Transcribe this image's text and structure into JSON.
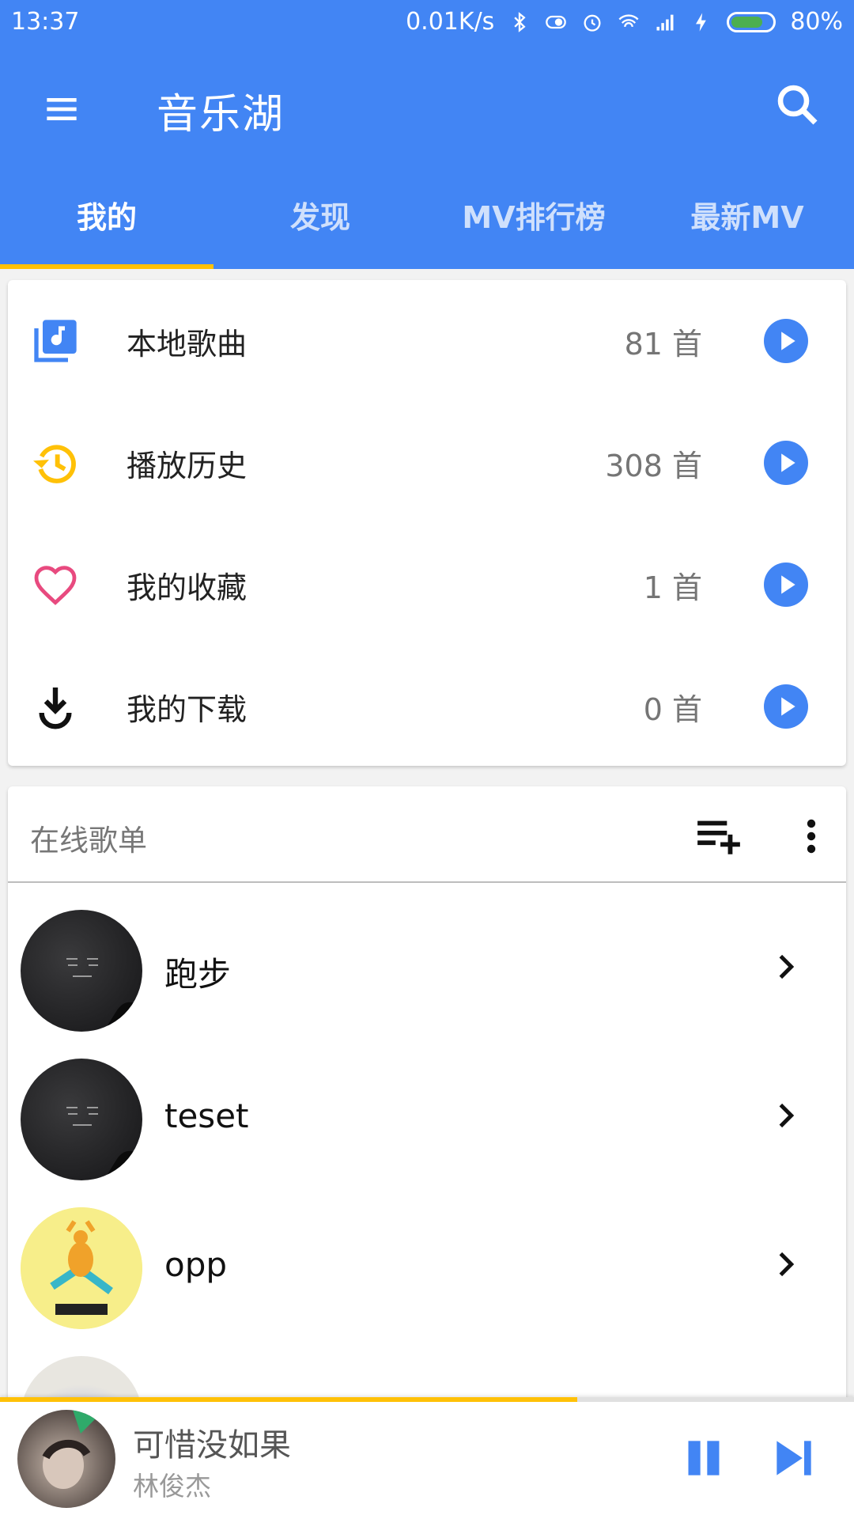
{
  "status_bar": {
    "time": "13:37",
    "speed": "0.01K/s",
    "battery": "80%",
    "battery_level": 0.8
  },
  "toolbar": {
    "title": "音乐湖",
    "menu_icon": "menu-icon",
    "search_icon": "search-icon"
  },
  "tabs": [
    {
      "label": "我的"
    },
    {
      "label": "发现"
    },
    {
      "label": "MV排行榜"
    },
    {
      "label": "最新MV"
    }
  ],
  "my_list": [
    {
      "label": "本地歌曲",
      "count": "81 首",
      "icon": "music-library-icon",
      "icon_color": "#4285f4"
    },
    {
      "label": "播放历史",
      "count": "308 首",
      "icon": "history-icon",
      "icon_color": "#ffc107"
    },
    {
      "label": "我的收藏",
      "count": "1 首",
      "icon": "heart-icon",
      "icon_color": "#e84a7f"
    },
    {
      "label": "我的下载",
      "count": "0 首",
      "icon": "download-icon",
      "icon_color": "#111111"
    }
  ],
  "online_playlists": {
    "header": "在线歌单",
    "items": [
      {
        "name": "跑步"
      },
      {
        "name": "teset"
      },
      {
        "name": "opp"
      }
    ]
  },
  "player": {
    "song": "可惜没如果",
    "artist": "林俊杰",
    "progress": 0.676
  },
  "colors": {
    "primary": "#4285f4",
    "accent": "#ffc107"
  }
}
